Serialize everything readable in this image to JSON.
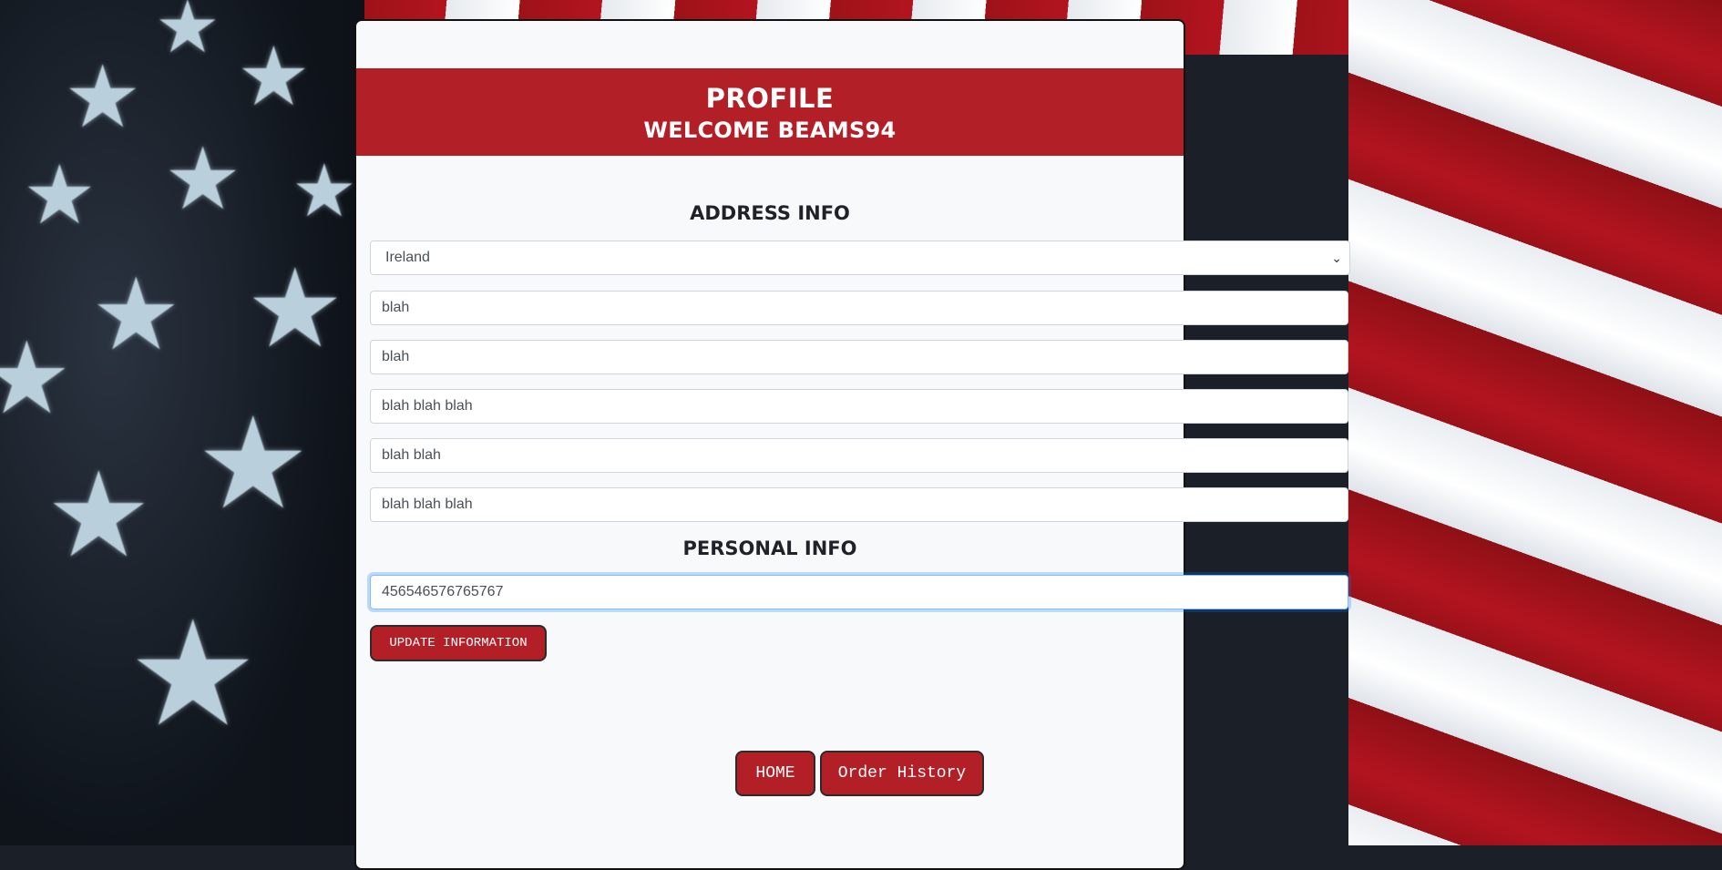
{
  "header": {
    "title": "PROFILE",
    "welcome": "WELCOME BEAMS94"
  },
  "address": {
    "heading": "ADDRESS INFO",
    "country": "Ireland",
    "fields": [
      "blah",
      "blah",
      "blah blah blah",
      "blah blah",
      "blah blah blah"
    ]
  },
  "personal": {
    "heading": "PERSONAL INFO",
    "phone": "456546576765767"
  },
  "actions": {
    "update_label": "UPDATE INFORMATION",
    "home_label": "HOME",
    "history_label": "Order History"
  },
  "colors": {
    "accent": "#b31f27",
    "focus_ring": "#80bdff"
  }
}
